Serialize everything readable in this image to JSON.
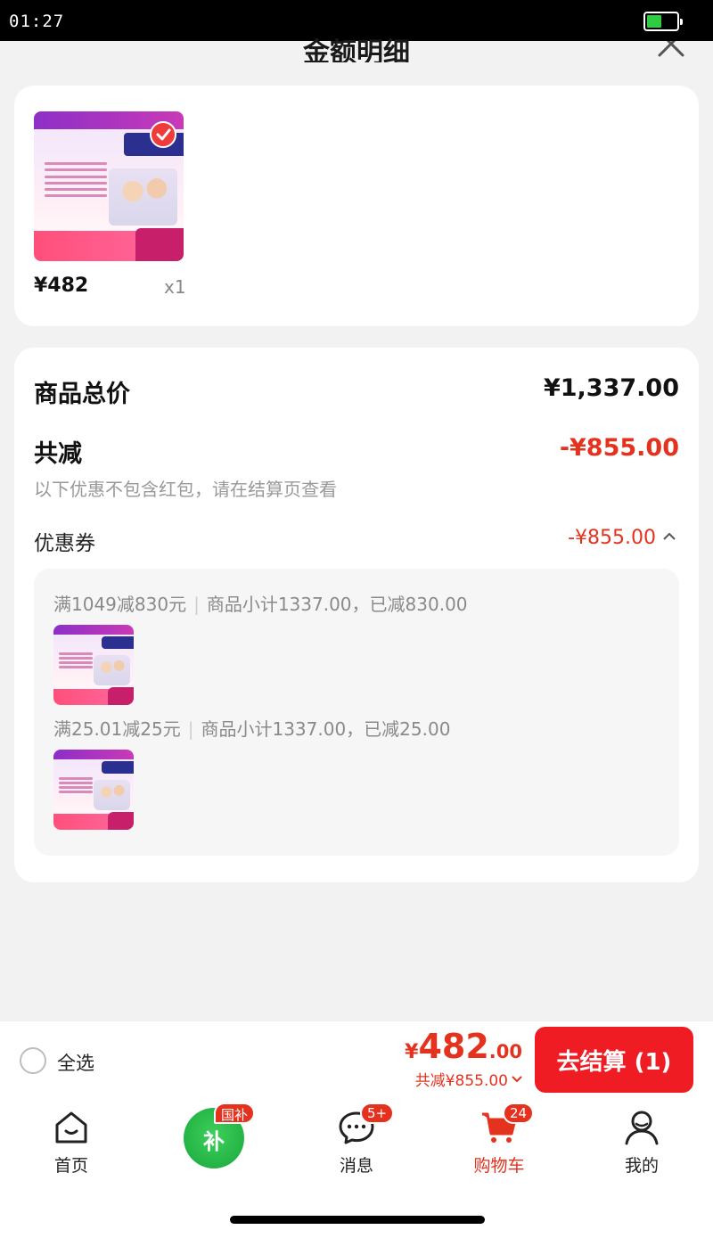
{
  "status_bar": {
    "time": "01:27"
  },
  "sheet": {
    "title": "金额明细"
  },
  "product": {
    "price": "¥482",
    "quantity": "x1"
  },
  "detail": {
    "total_label": "商品总价",
    "total_value": "¥1,337.00",
    "reduce_label": "共减",
    "reduce_value": "-¥855.00",
    "reduce_note": "以下优惠不包含红包，请在结算页查看",
    "coupon_label": "优惠券",
    "coupon_value": "-¥855.00",
    "coupons": [
      {
        "rule": "满1049减830元",
        "summary": "商品小计1337.00，已减830.00"
      },
      {
        "rule": "满25.01减25元",
        "summary": "商品小计1337.00，已减25.00"
      }
    ]
  },
  "checkout": {
    "select_all_label": "全选",
    "currency": "¥",
    "total_int": "482",
    "total_dec": ".00",
    "reduce_text": "共减¥855.00",
    "button_label": "去结算 (1)"
  },
  "tabs": [
    {
      "label": "首页",
      "icon": "home-icon"
    },
    {
      "label": "",
      "icon": "subsidy-icon",
      "badge": "国补",
      "char": "补"
    },
    {
      "label": "消息",
      "icon": "message-icon",
      "badge": "5+"
    },
    {
      "label": "购物车",
      "icon": "cart-icon",
      "badge": "24"
    },
    {
      "label": "我的",
      "icon": "profile-icon"
    }
  ],
  "colors": {
    "accent": "#e4321f",
    "checkout_button": "#ef1c24",
    "subsidy_green": "#17a83b"
  }
}
